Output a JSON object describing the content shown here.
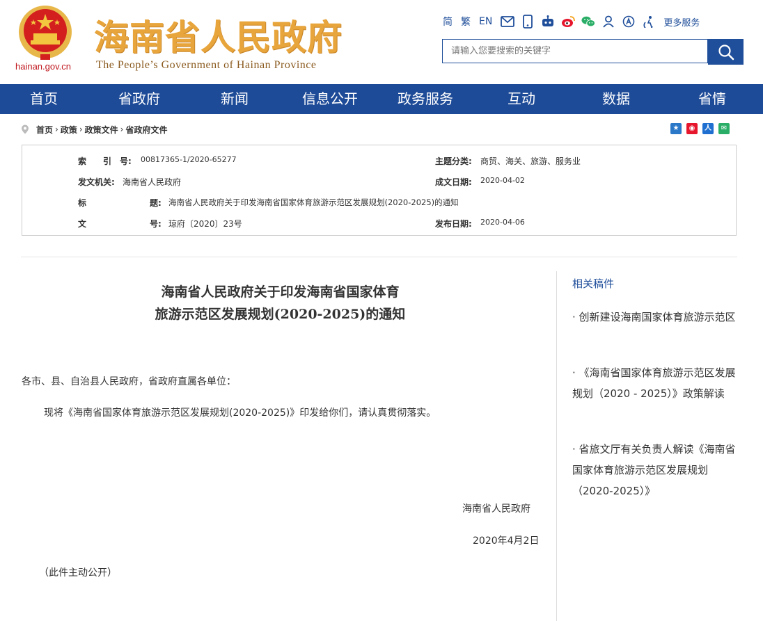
{
  "header": {
    "domain": "hainan.gov.cn",
    "title": "海南省人民政府",
    "subtitle": "The People’s Government  of Hainan Province",
    "lang_links": [
      "简",
      "繁",
      "EN"
    ],
    "more_services": "更多服务",
    "search_placeholder": "请输入您要搜索的关键字",
    "icons": [
      "mail-icon",
      "mobile-icon",
      "robot-icon",
      "weibo-icon",
      "wechat-icon",
      "user-icon",
      "accessibility-icon",
      "elderly-icon"
    ]
  },
  "nav": [
    "首页",
    "省政府",
    "新闻",
    "信息公开",
    "政务服务",
    "互动",
    "数据",
    "省情"
  ],
  "breadcrumb": [
    "首页",
    "政策",
    "政策文件",
    "省政府文件"
  ],
  "meta": {
    "index_label": "索　　引　号:",
    "index_value": "00817365-1/2020-65277",
    "topic_label": "主题分类:",
    "topic_value": "商贸、海关、旅游、服务业",
    "issuer_label": "发文机关:",
    "issuer_value": "海南省人民政府",
    "created_label": "成文日期:",
    "created_value": "2020-04-02",
    "title_label_a": "标",
    "title_label_b": "题:",
    "title_value": "海南省人民政府关于印发海南省国家体育旅游示范区发展规划(2020-2025)的通知",
    "doc_label_a": "文",
    "doc_label_b": "号:",
    "doc_value": "琼府〔2020〕23号",
    "published_label": "发布日期:",
    "published_value": "2020-04-06"
  },
  "article": {
    "title_line1": "海南省人民政府关于印发海南省国家体育",
    "title_line2": "旅游示范区发展规划(2020-2025)的通知",
    "greeting": "各市、县、自治县人民政府，省政府直属各单位：",
    "body": "现将《海南省国家体育旅游示范区发展规划(2020-2025)》印发给你们，请认真贯彻落实。",
    "signature": "海南省人民政府",
    "date": "2020年4月2日",
    "note": "（此件主动公开）"
  },
  "sidebar": {
    "title": "相关稿件",
    "items": [
      "· 创新建设海南国家体育旅游示范区",
      "· 《海南省国家体育旅游示范区发展规划（2020 - 2025）》政策解读",
      "· 省旅文厅有关负责人解读《海南省国家体育旅游示范区发展规划（2020-2025）》"
    ]
  },
  "colors": {
    "nav_blue": "#1e4b98",
    "title_gold": "#e8a53b",
    "link_blue": "#1f4e9a"
  }
}
